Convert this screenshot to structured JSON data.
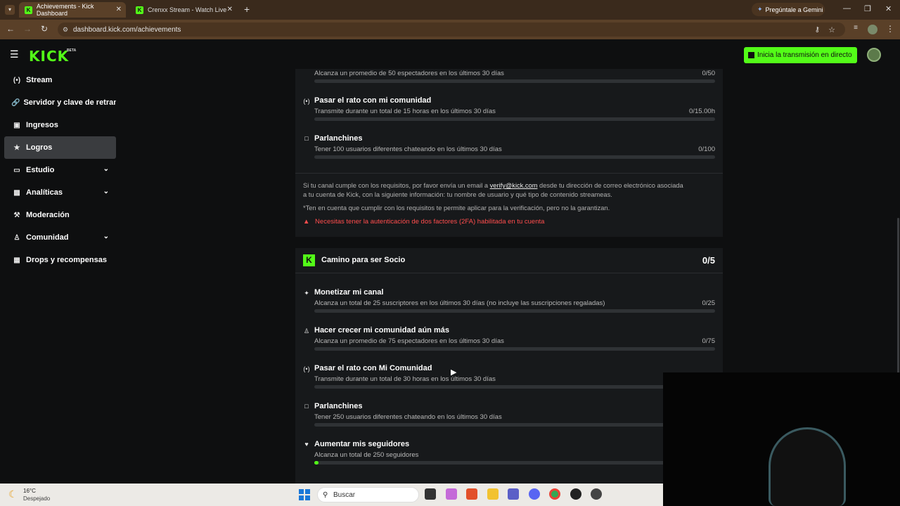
{
  "browser": {
    "tabs": [
      {
        "title": "Achievements - Kick Dashboard",
        "favicon": "K"
      },
      {
        "title": "Crenxx Stream - Watch Live on",
        "favicon": "K"
      }
    ],
    "new_tab": "+",
    "url": "dashboard.kick.com/achievements",
    "gemini_label": "Pregúntale a Gemini"
  },
  "header": {
    "logo": "KICK",
    "beta": "BETA",
    "golive_label": "Inicia la transmisión en directo"
  },
  "sidebar": {
    "items": [
      {
        "label": "Stream",
        "icon": "broadcast-icon"
      },
      {
        "label": "Servidor y clave de retrans",
        "icon": "link-icon"
      },
      {
        "label": "Ingresos",
        "icon": "wallet-icon"
      },
      {
        "label": "Logros",
        "icon": "trophy-icon"
      },
      {
        "label": "Estudio",
        "icon": "monitor-icon"
      },
      {
        "label": "Analíticas",
        "icon": "chart-icon"
      },
      {
        "label": "Moderación",
        "icon": "hammer-icon"
      },
      {
        "label": "Comunidad",
        "icon": "community-icon"
      },
      {
        "label": "Drops y recompensas",
        "icon": "gift-icon"
      }
    ]
  },
  "verification": {
    "rows": [
      {
        "title": "",
        "desc": "Alcanza un promedio de 50 espectadores en los últimos 30 días",
        "value": "0/50",
        "progress": 0
      },
      {
        "title": "Pasar el rato con mi comunidad",
        "desc": "Transmite durante un total de 15 horas en los últimos 30 días",
        "value": "0/15.00h",
        "progress": 0
      },
      {
        "title": "Parlanchines",
        "desc": "Tener 100 usuarios diferentes chateando en los últimos 30 días",
        "value": "0/100",
        "progress": 0
      }
    ],
    "note_pre": "Si tu canal cumple con los requisitos, por favor envía un email a",
    "note_email": "verify@kick.com",
    "note_post": "desde tu dirección de correo electrónico asociada",
    "note_line2": "a tu cuenta de Kick, con la siguiente información: tu nombre de usuario y qué tipo de contenido streameas.",
    "disclaimer": "*Ten en cuenta que cumplir con los requisitos te permite aplicar para la verificación, pero no la garantizan.",
    "warning": "Necesitas tener la autenticación de dos factores (2FA) habilitada en tu cuenta"
  },
  "partner": {
    "title": "Camino para ser Socio",
    "count": "0/5",
    "rows": [
      {
        "title": "Monetizar mi canal",
        "desc": "Alcanza un total de 25 suscriptores en los últimos 30 días (no incluye las suscripciones regaladas)",
        "value": "0/25",
        "progress": 0
      },
      {
        "title": "Hacer crecer mi comunidad aún más",
        "desc": "Alcanza un promedio de 75 espectadores en los últimos 30 días",
        "value": "0/75",
        "progress": 0
      },
      {
        "title": "Pasar el rato con Mi Comunidad",
        "desc": "Transmite durante un total de 30 horas en los últimos 30 días",
        "value": "",
        "progress": 0
      },
      {
        "title": "Parlanchines",
        "desc": "Tener 250 usuarios diferentes chateando en los últimos 30 días",
        "value": "",
        "progress": 0
      },
      {
        "title": "Aumentar mis seguidores",
        "desc": "Alcanza un total de 250 seguidores",
        "value": "",
        "progress": 0.01
      }
    ]
  },
  "taskbar": {
    "temp": "16°C",
    "weather": "Despejado",
    "search_placeholder": "Buscar"
  }
}
